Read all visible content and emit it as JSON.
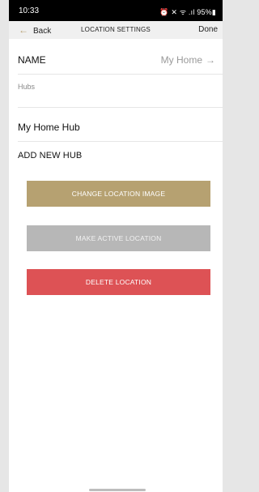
{
  "status_bar": {
    "time": "10:33",
    "icons_text": "⏰ ✕ ᯤ .ıl 95%▮"
  },
  "nav": {
    "back_label": "Back",
    "title": "LOCATION SETTINGS",
    "done_label": "Done"
  },
  "name_field": {
    "label": "NAME",
    "value": "My Home"
  },
  "hubs": {
    "section_label": "Hubs",
    "items": [
      {
        "name": "My Home Hub"
      }
    ],
    "add_label": "ADD NEW HUB"
  },
  "actions": {
    "change_image": "CHANGE LOCATION IMAGE",
    "make_active": "MAKE ACTIVE LOCATION",
    "delete": "DELETE LOCATION"
  },
  "colors": {
    "accent": "#b6a171",
    "disabled": "#b7b7b7",
    "danger": "#dd5255"
  },
  "icons": {
    "back": "arrow-left-icon",
    "name_chevron": "arrow-right-icon"
  }
}
